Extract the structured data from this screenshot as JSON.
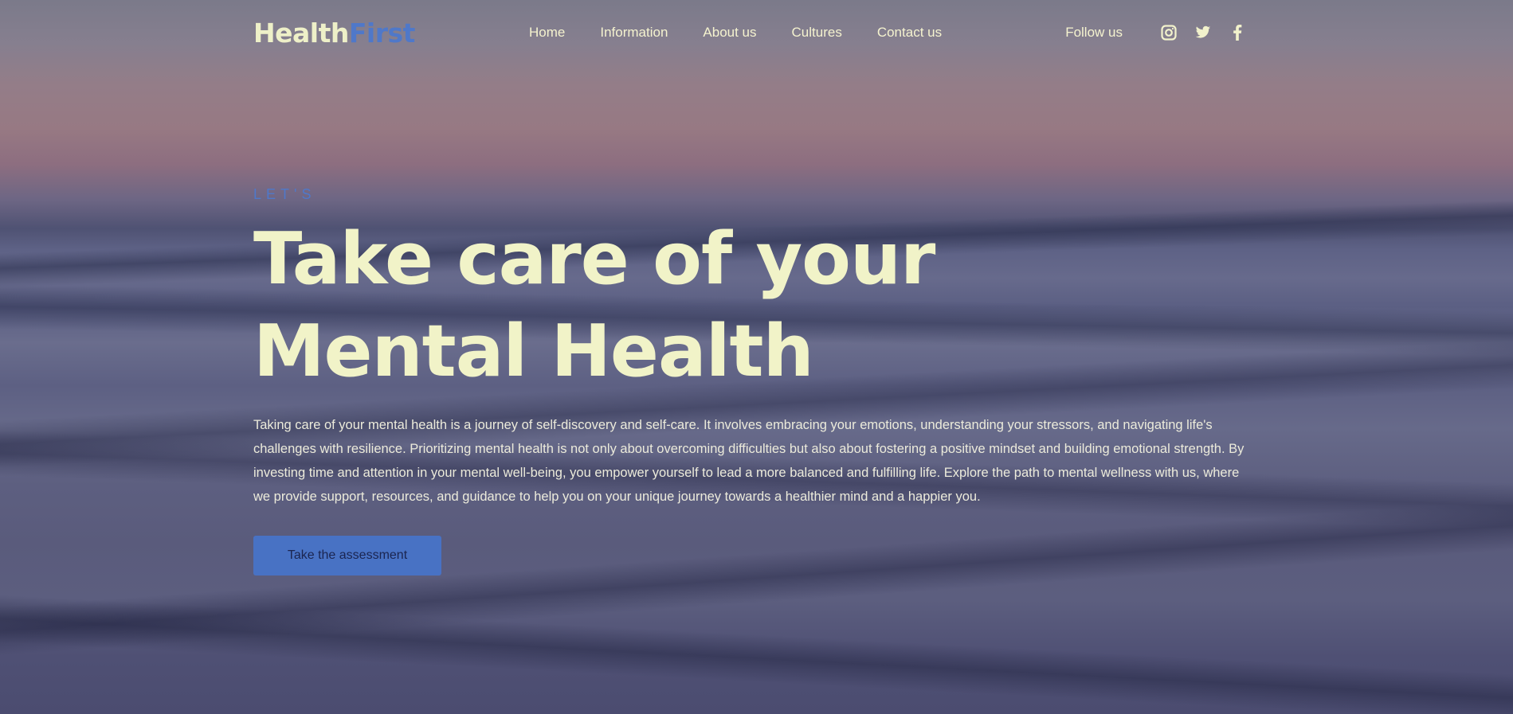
{
  "brand": {
    "name_part1": "Health",
    "name_part2": "First"
  },
  "nav": {
    "items": [
      {
        "label": "Home"
      },
      {
        "label": "Information"
      },
      {
        "label": "About us"
      },
      {
        "label": "Cultures"
      },
      {
        "label": "Contact us"
      }
    ],
    "follow_label": "Follow us",
    "social_icons": [
      "instagram-icon",
      "twitter-icon",
      "facebook-icon"
    ]
  },
  "hero": {
    "eyebrow": "LET'S",
    "headline_line1": "Take care of your",
    "headline_line2": "Mental Health",
    "description": "Taking care of your mental health is a journey of self-discovery and self-care. It involves embracing your emotions, understanding your stressors, and navigating life's challenges with resilience. Prioritizing mental health is not only about overcoming difficulties but also about fostering a positive mindset and building emotional strength. By investing time and attention in your mental well-being, you empower yourself to lead a more balanced and fulfilling life. Explore the path to mental wellness with us, where we provide support, resources, and guidance to help you on your unique journey towards a healthier mind and a happier you.",
    "cta_label": "Take the assessment"
  },
  "colors": {
    "accent": "#4f78c9",
    "headline": "#f1f3c8",
    "button_bg": "#4872c4"
  }
}
